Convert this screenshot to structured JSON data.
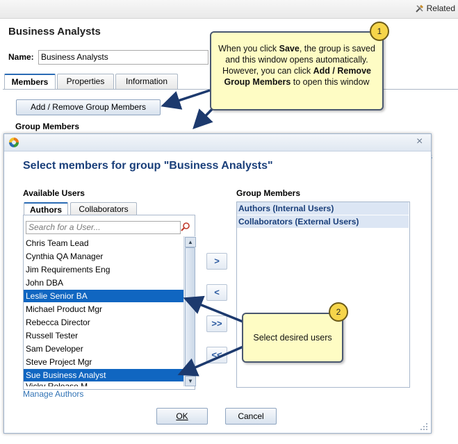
{
  "topbar": {
    "related_label": "Related"
  },
  "page": {
    "title": "Business Analysts",
    "name_label": "Name:",
    "name_value": "Business Analysts",
    "tabs": [
      "Members",
      "Properties",
      "Information"
    ],
    "add_remove_button": "Add / Remove Group Members",
    "group_members_header": "Group Members",
    "bg_link_fragment": "rs"
  },
  "callout1": {
    "number": "1",
    "text_before": "When you click ",
    "bold1": "Save",
    "text_middle": ", the group is saved and this window opens automatically. However, you can click ",
    "bold2": "Add / Remove Group Members",
    "text_after": " to open this window"
  },
  "callout2": {
    "number": "2",
    "text": "Select desired users"
  },
  "modal": {
    "title": "Select members for group \"Business Analysts\"",
    "available_users_label": "Available Users",
    "tabs": [
      "Authors",
      "Collaborators"
    ],
    "search_placeholder": "Search for a User...",
    "users": [
      "Chris Team Lead",
      "Cynthia QA Manager",
      "Jim Requirements Eng",
      "John DBA",
      "Leslie Senior BA",
      "Michael Product Mgr",
      "Rebecca Director",
      "Russell Tester",
      "Sam Developer",
      "Steve Project Mgr",
      "Sue Business Analyst",
      "Vicky Release M"
    ],
    "selected_users": [
      "Leslie Senior BA",
      "Sue Business Analyst"
    ],
    "move_buttons": [
      ">",
      "<",
      ">>",
      "<<"
    ],
    "group_members_label": "Group Members",
    "group_members": [
      "Authors (Internal Users)",
      "Collaborators (External Users)"
    ],
    "manage_link": "Manage Authors",
    "ok_label": "OK",
    "cancel_label": "Cancel",
    "close_glyph": "×"
  },
  "colors": {
    "selection": "#1066c1",
    "title": "#1a3f7a",
    "callout": "#fefcc4",
    "badge": "#f6d54a",
    "link": "#3173b5"
  }
}
